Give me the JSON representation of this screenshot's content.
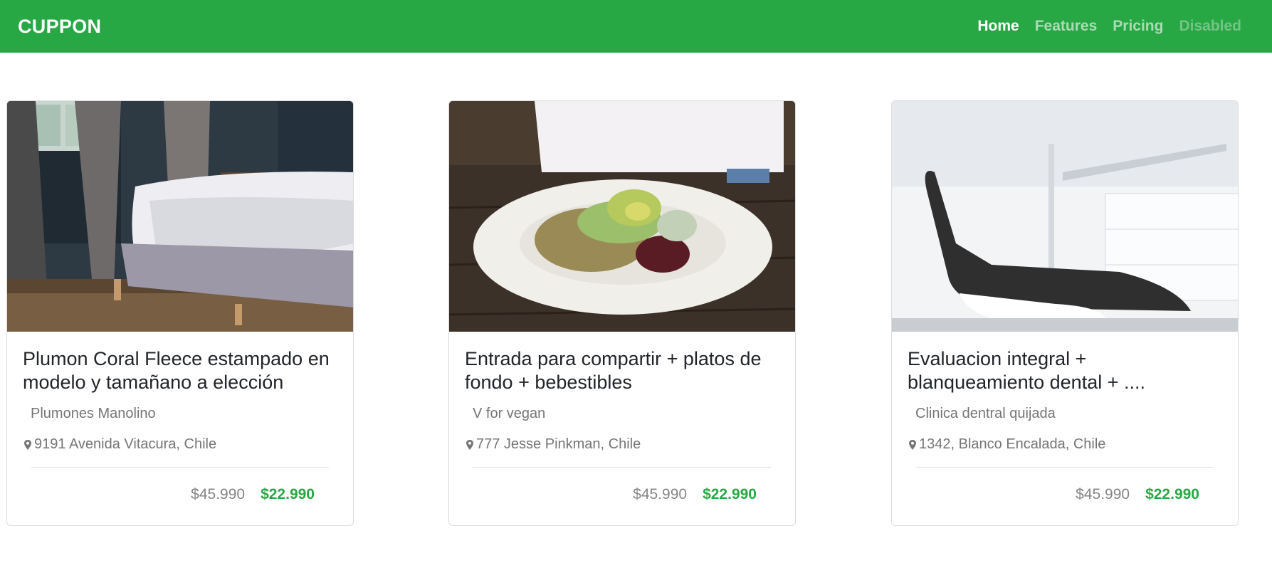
{
  "navbar": {
    "brand": "CUPPON",
    "links": [
      {
        "label": "Home"
      },
      {
        "label": "Features"
      },
      {
        "label": "Pricing"
      },
      {
        "label": "Disabled"
      }
    ]
  },
  "colors": {
    "brand_green": "#28a745"
  },
  "cards": [
    {
      "title": "Plumon Coral Fleece estampado en modelo y tamañano a elección",
      "merchant": "Plumones Manolino",
      "location": "9191 Avenida Vitacura, Chile",
      "old_price": "$45.990",
      "new_price": "$22.990"
    },
    {
      "title": "Entrada para compartir + platos de fondo + bebestibles",
      "merchant": "V for vegan",
      "location": "777 Jesse Pinkman, Chile",
      "old_price": "$45.990",
      "new_price": "$22.990"
    },
    {
      "title": "Evaluacion integral + blanqueamiento dental + ....",
      "merchant": "Clinica dentral quijada",
      "location": "1342, Blanco Encalada, Chile",
      "old_price": "$45.990",
      "new_price": "$22.990"
    }
  ]
}
